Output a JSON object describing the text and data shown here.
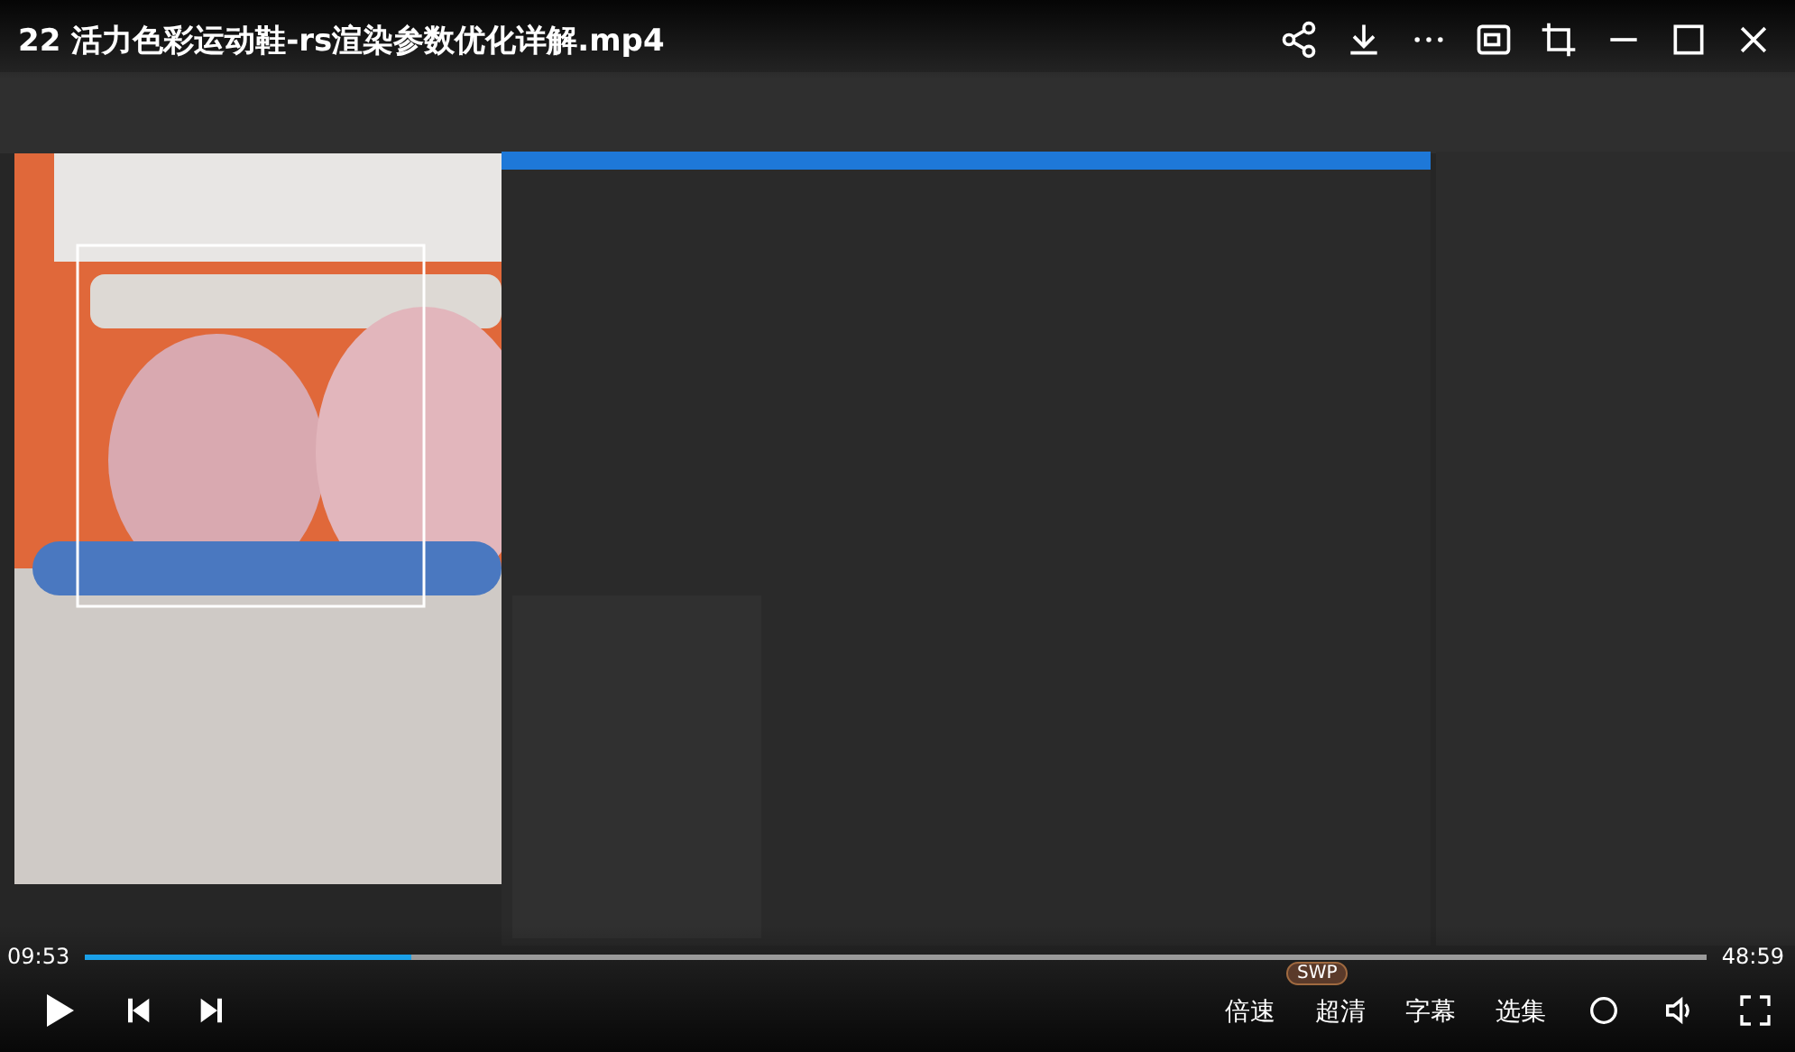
{
  "title": "22 活力色彩运动鞋-rs渲染参数优化详解.mp4",
  "player": {
    "current_time": "09:53",
    "duration": "48:59",
    "progress": {
      "level": 0.202
    },
    "options": [
      {
        "label": "倍速"
      },
      {
        "label": "超清",
        "badge": "SWP"
      },
      {
        "label": "字幕"
      },
      {
        "label": "选集"
      }
    ]
  }
}
